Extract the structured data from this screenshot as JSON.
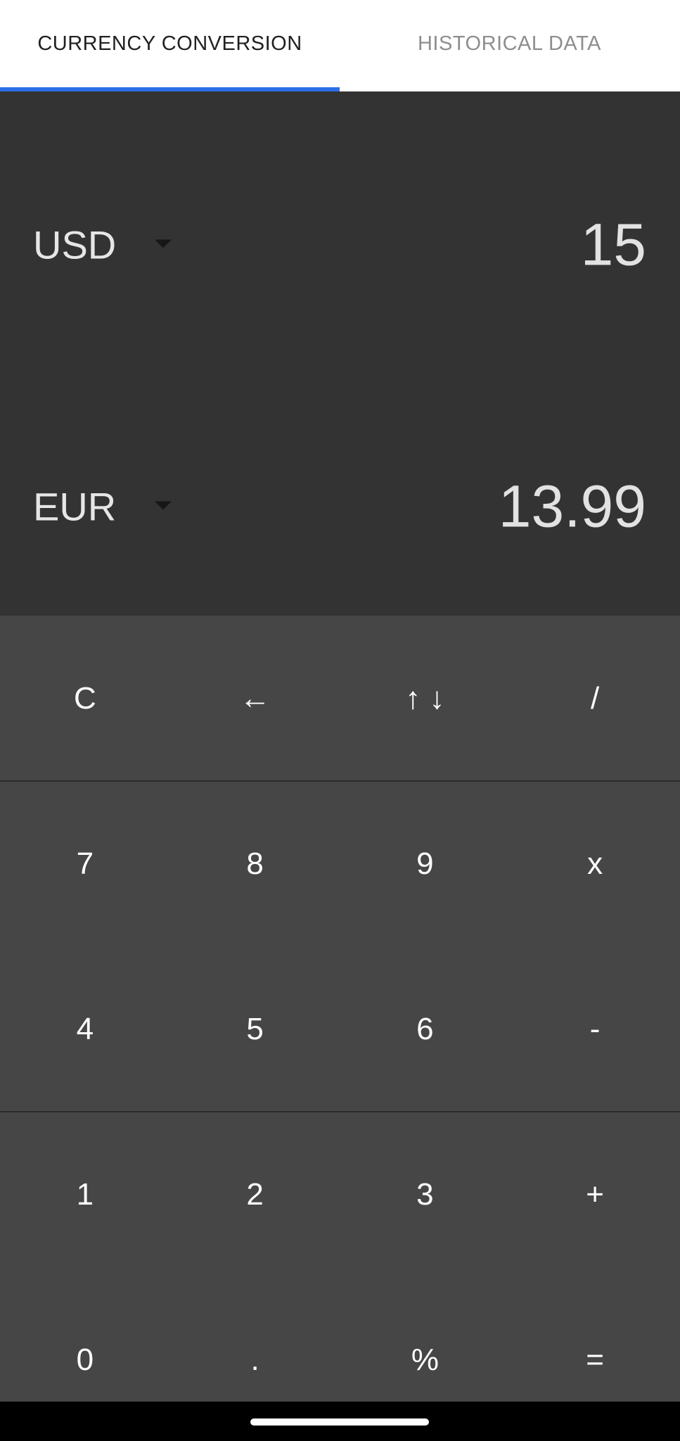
{
  "tabs": {
    "active_label": "CURRENCY CONVERSION",
    "inactive_label": "HISTORICAL DATA",
    "accent_color": "#2d6ee6"
  },
  "converter": {
    "from": {
      "currency": "USD",
      "amount": "15"
    },
    "to": {
      "currency": "EUR",
      "amount": "13.99"
    }
  },
  "keypad": {
    "rows": [
      [
        "C",
        "←",
        "↑ ↓",
        "/"
      ],
      [
        "7",
        "8",
        "9",
        "x"
      ],
      [
        "4",
        "5",
        "6",
        "-"
      ],
      [
        "1",
        "2",
        "3",
        "+"
      ],
      [
        "0",
        ".",
        "%",
        "="
      ]
    ]
  }
}
